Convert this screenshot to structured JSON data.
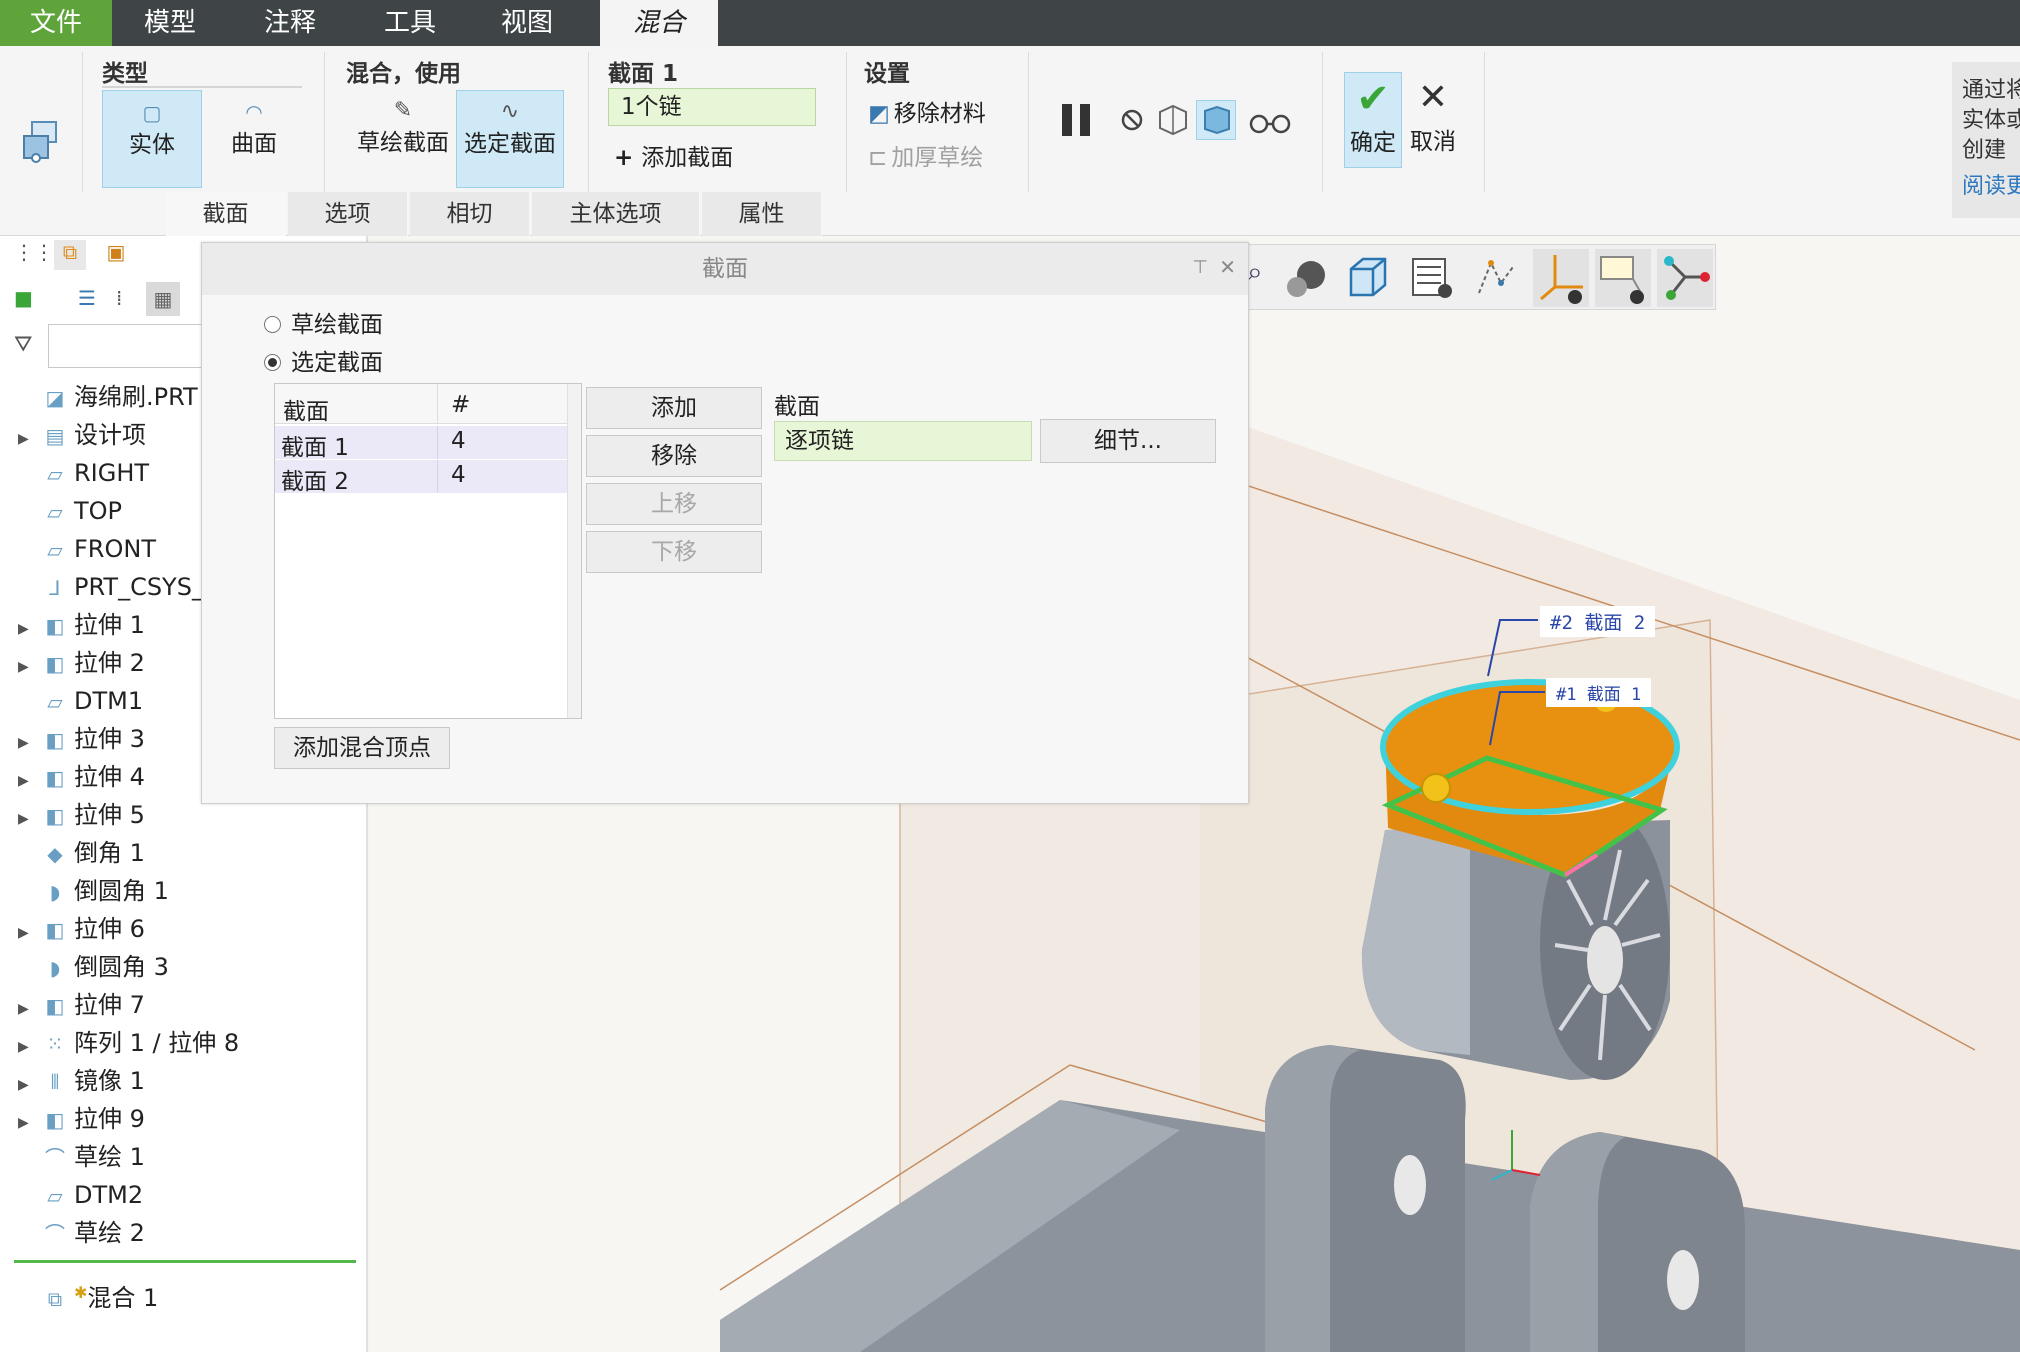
{
  "menubar": {
    "tabs": [
      "文件",
      "模型",
      "注释",
      "工具",
      "视图",
      "混合"
    ]
  },
  "ribbon": {
    "type_group": {
      "title": "类型",
      "solid": "实体",
      "surface": "曲面"
    },
    "blend_group": {
      "title": "混合，使用",
      "sketch_section": "草绘截面",
      "selected_section": "选定截面"
    },
    "section_group": {
      "title": "截面 1",
      "chain_value": "1个链",
      "add_section": "添加截面"
    },
    "settings_group": {
      "title": "设置",
      "remove_material": "移除材料",
      "thicken_sketch": "加厚草绘"
    },
    "ok": "确定",
    "cancel": "取消",
    "subtabs": [
      "截面",
      "选项",
      "相切",
      "主体选项",
      "属性"
    ]
  },
  "help": {
    "lines": [
      "通过将",
      "实体或",
      "创建"
    ],
    "link": "阅读更"
  },
  "tree": {
    "items": [
      {
        "label": "海绵刷.PRT",
        "icon": "part-icon",
        "expand": false
      },
      {
        "label": "设计项",
        "icon": "design-items-icon",
        "expand": true
      },
      {
        "label": "RIGHT",
        "icon": "datum-plane-icon",
        "expand": false
      },
      {
        "label": "TOP",
        "icon": "datum-plane-icon",
        "expand": false
      },
      {
        "label": "FRONT",
        "icon": "datum-plane-icon",
        "expand": false
      },
      {
        "label": "PRT_CSYS_",
        "icon": "csys-icon",
        "expand": false
      },
      {
        "label": "拉伸 1",
        "icon": "extrude-icon",
        "expand": true
      },
      {
        "label": "拉伸 2",
        "icon": "extrude-icon",
        "expand": true
      },
      {
        "label": "DTM1",
        "icon": "datum-plane-icon",
        "expand": false
      },
      {
        "label": "拉伸 3",
        "icon": "extrude-icon",
        "expand": true
      },
      {
        "label": "拉伸 4",
        "icon": "extrude-icon",
        "expand": true
      },
      {
        "label": "拉伸 5",
        "icon": "extrude-icon",
        "expand": true
      },
      {
        "label": "倒角 1",
        "icon": "chamfer-icon",
        "expand": false
      },
      {
        "label": "倒圆角 1",
        "icon": "round-icon",
        "expand": false
      },
      {
        "label": "拉伸 6",
        "icon": "extrude-icon",
        "expand": true
      },
      {
        "label": "倒圆角 3",
        "icon": "round-icon",
        "expand": false
      },
      {
        "label": "拉伸 7",
        "icon": "extrude-icon",
        "expand": true
      },
      {
        "label": "阵列 1 / 拉伸 8",
        "icon": "pattern-icon",
        "expand": true
      },
      {
        "label": "镜像 1",
        "icon": "mirror-icon",
        "expand": true
      },
      {
        "label": "拉伸 9",
        "icon": "extrude-icon",
        "expand": true
      },
      {
        "label": "草绘 1",
        "icon": "sketch-icon",
        "expand": false
      },
      {
        "label": "DTM2",
        "icon": "datum-plane-icon",
        "expand": false
      },
      {
        "label": "草绘 2",
        "icon": "sketch-icon",
        "expand": false
      }
    ],
    "active_feature": "混合 1"
  },
  "dialog": {
    "title": "截面",
    "radio_sketch": "草绘截面",
    "radio_selected": "选定截面",
    "selected_mode": "选定截面",
    "table_headers": [
      "截面",
      "#"
    ],
    "rows": [
      [
        "截面 1",
        "4"
      ],
      [
        "截面 2",
        "4"
      ]
    ],
    "btn_add": "添加",
    "btn_remove": "移除",
    "btn_up": "上移",
    "btn_down": "下移",
    "btn_add_vertex": "添加混合顶点",
    "section_label": "截面",
    "section_value": "逐项链",
    "btn_details": "细节..."
  },
  "annotations": {
    "label2": "#2 截面 2",
    "label1": "#1 截面 1"
  },
  "colors": {
    "file_tab": "#5ea43a",
    "menubar": "#3f4447",
    "selected_button": "#cfeaf6",
    "input_green": "#e6f6d6",
    "blend_orange": "#e28a10",
    "section_cyan": "#3fd2dc",
    "section_green": "#43c24a"
  }
}
